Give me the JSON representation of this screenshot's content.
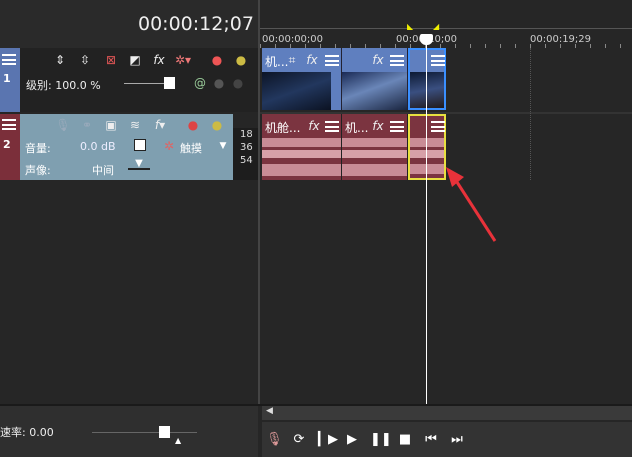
{
  "timecode": "00:00:12;07",
  "ruler": {
    "marks": [
      "00:00:00;00",
      "00:00:10;00",
      "00:00:19;29"
    ]
  },
  "track1": {
    "number": "1",
    "level_label": "级别: 100.0 %"
  },
  "track2": {
    "number": "2",
    "volume_label": "音量:",
    "volume_value": "0.0 dB",
    "pan_label": "声像:",
    "pan_value": "中间",
    "automation": "触摸",
    "meter": [
      "18",
      "36",
      "54"
    ]
  },
  "video_clips": [
    {
      "title": "机..."
    },
    {
      "title": ""
    },
    {
      "title": ""
    }
  ],
  "audio_clips": [
    {
      "title": "机舱..."
    },
    {
      "title": "机..."
    },
    {
      "title": ""
    }
  ],
  "rate_label": "速率: 0.00",
  "colors": {
    "video_track": "#5f7fbf",
    "audio_track": "#7b3440",
    "audio_header": "#7f9fb0",
    "selection": "#e8e040",
    "arrow": "#e8323a"
  }
}
